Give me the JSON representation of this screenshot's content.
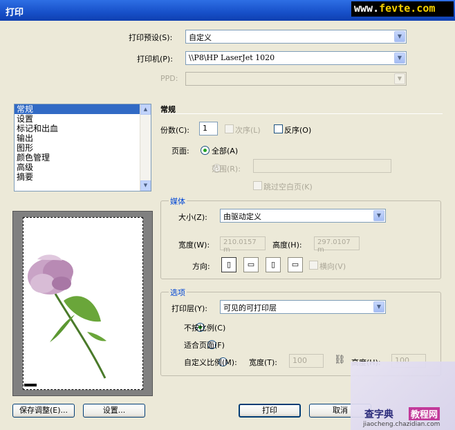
{
  "window": {
    "title": "打印"
  },
  "watermark_top": {
    "prefix": "www.",
    "domain": "fevte.com"
  },
  "preset": {
    "label": "打印预设(S):",
    "value": "自定义"
  },
  "printer": {
    "label": "打印机(P):",
    "value": "\\\\P8\\HP LaserJet 1020"
  },
  "ppd": {
    "label": "PPD:",
    "value": ""
  },
  "sidebar": {
    "items": [
      {
        "label": "常规"
      },
      {
        "label": "设置"
      },
      {
        "label": "标记和出血"
      },
      {
        "label": "输出"
      },
      {
        "label": "图形"
      },
      {
        "label": "颜色管理"
      },
      {
        "label": "高级"
      },
      {
        "label": "摘要"
      }
    ],
    "selected": 0
  },
  "general": {
    "section_title": "常规",
    "copies_label": "份数(C):",
    "copies_value": "1",
    "collate_label": "次序(L)",
    "reverse_label": "反序(O)",
    "pages_label": "页面:",
    "all_label": "全部(A)",
    "range_label": "范围(R):",
    "range_value": "",
    "skip_blank_label": "跳过空白页(K)"
  },
  "media": {
    "group_title": "媒体",
    "size_label": "大小(Z):",
    "size_value": "由驱动定义",
    "width_label": "宽度(W):",
    "width_value": "210.0157 m",
    "height_label": "高度(H):",
    "height_value": "297.0107 m",
    "orientation_label": "方向:",
    "orientation_icons": [
      "portrait-icon",
      "landscape-icon",
      "reverse-portrait-icon",
      "reverse-landscape-icon"
    ],
    "transverse_label": "横向(V)"
  },
  "options": {
    "group_title": "选项",
    "layers_label": "打印层(Y):",
    "layers_value": "可见的可打印层",
    "no_scale_label": "不按比例(C)",
    "fit_label": "适合页面(F)",
    "custom_label": "自定义比例(M):",
    "width_label": "宽度(T):",
    "width_value": "100",
    "height_label": "高度(H):",
    "height_value": "100",
    "scale_choice": "no_scale"
  },
  "buttons": {
    "save_preset": "保存调整(E)...",
    "setup": "设置...",
    "print": "打印",
    "cancel": "取消"
  },
  "watermark_bottom": {
    "a": "查字典",
    "b": "教程网",
    "c": "jiaocheng.chazidian.com"
  },
  "colors": {
    "title_bar": "#1750c9",
    "selection": "#316ac5",
    "group_title": "#0046d5",
    "dialog_bg": "#ece9d8"
  }
}
